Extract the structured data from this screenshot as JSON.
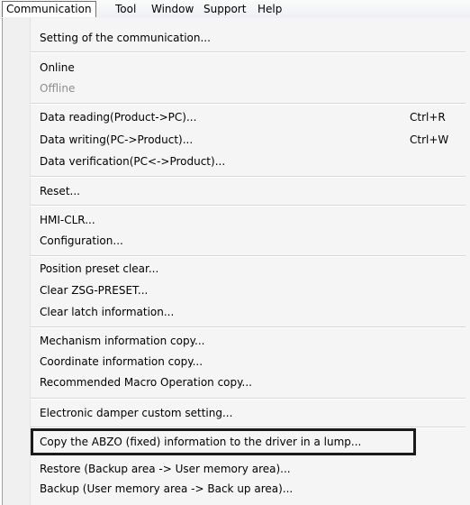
{
  "menubar": {
    "items": [
      "Communication",
      "Tool",
      "Window",
      "Support",
      "Help"
    ]
  },
  "menu": {
    "items": [
      {
        "label": "Setting of the communication...",
        "enabled": true
      },
      {
        "label": "Online",
        "enabled": true
      },
      {
        "label": "Offline",
        "enabled": false
      },
      {
        "label": "Data reading(Product->PC)...",
        "shortcut": "Ctrl+R",
        "enabled": true
      },
      {
        "label": "Data writing(PC->Product)...",
        "shortcut": "Ctrl+W",
        "enabled": true
      },
      {
        "label": "Data verification(PC<->Product)...",
        "enabled": true
      },
      {
        "label": "Reset...",
        "enabled": true
      },
      {
        "label": "HMI-CLR...",
        "enabled": true
      },
      {
        "label": "Configuration...",
        "enabled": true
      },
      {
        "label": "Position preset clear...",
        "enabled": true
      },
      {
        "label": "Clear ZSG-PRESET...",
        "enabled": true
      },
      {
        "label": "Clear latch information...",
        "enabled": true
      },
      {
        "label": "Mechanism information copy...",
        "enabled": true
      },
      {
        "label": "Coordinate information copy...",
        "enabled": true
      },
      {
        "label": "Recommended Macro Operation copy...",
        "enabled": true
      },
      {
        "label": "Electronic damper custom setting...",
        "enabled": true
      },
      {
        "label": "Copy the ABZO (fixed) information to the driver in a lump...",
        "enabled": true,
        "highlighted": true
      },
      {
        "label": "Restore (Backup area -> User memory area)...",
        "enabled": true
      },
      {
        "label": "Backup (User memory area -> Back up area)...",
        "enabled": true
      }
    ]
  }
}
